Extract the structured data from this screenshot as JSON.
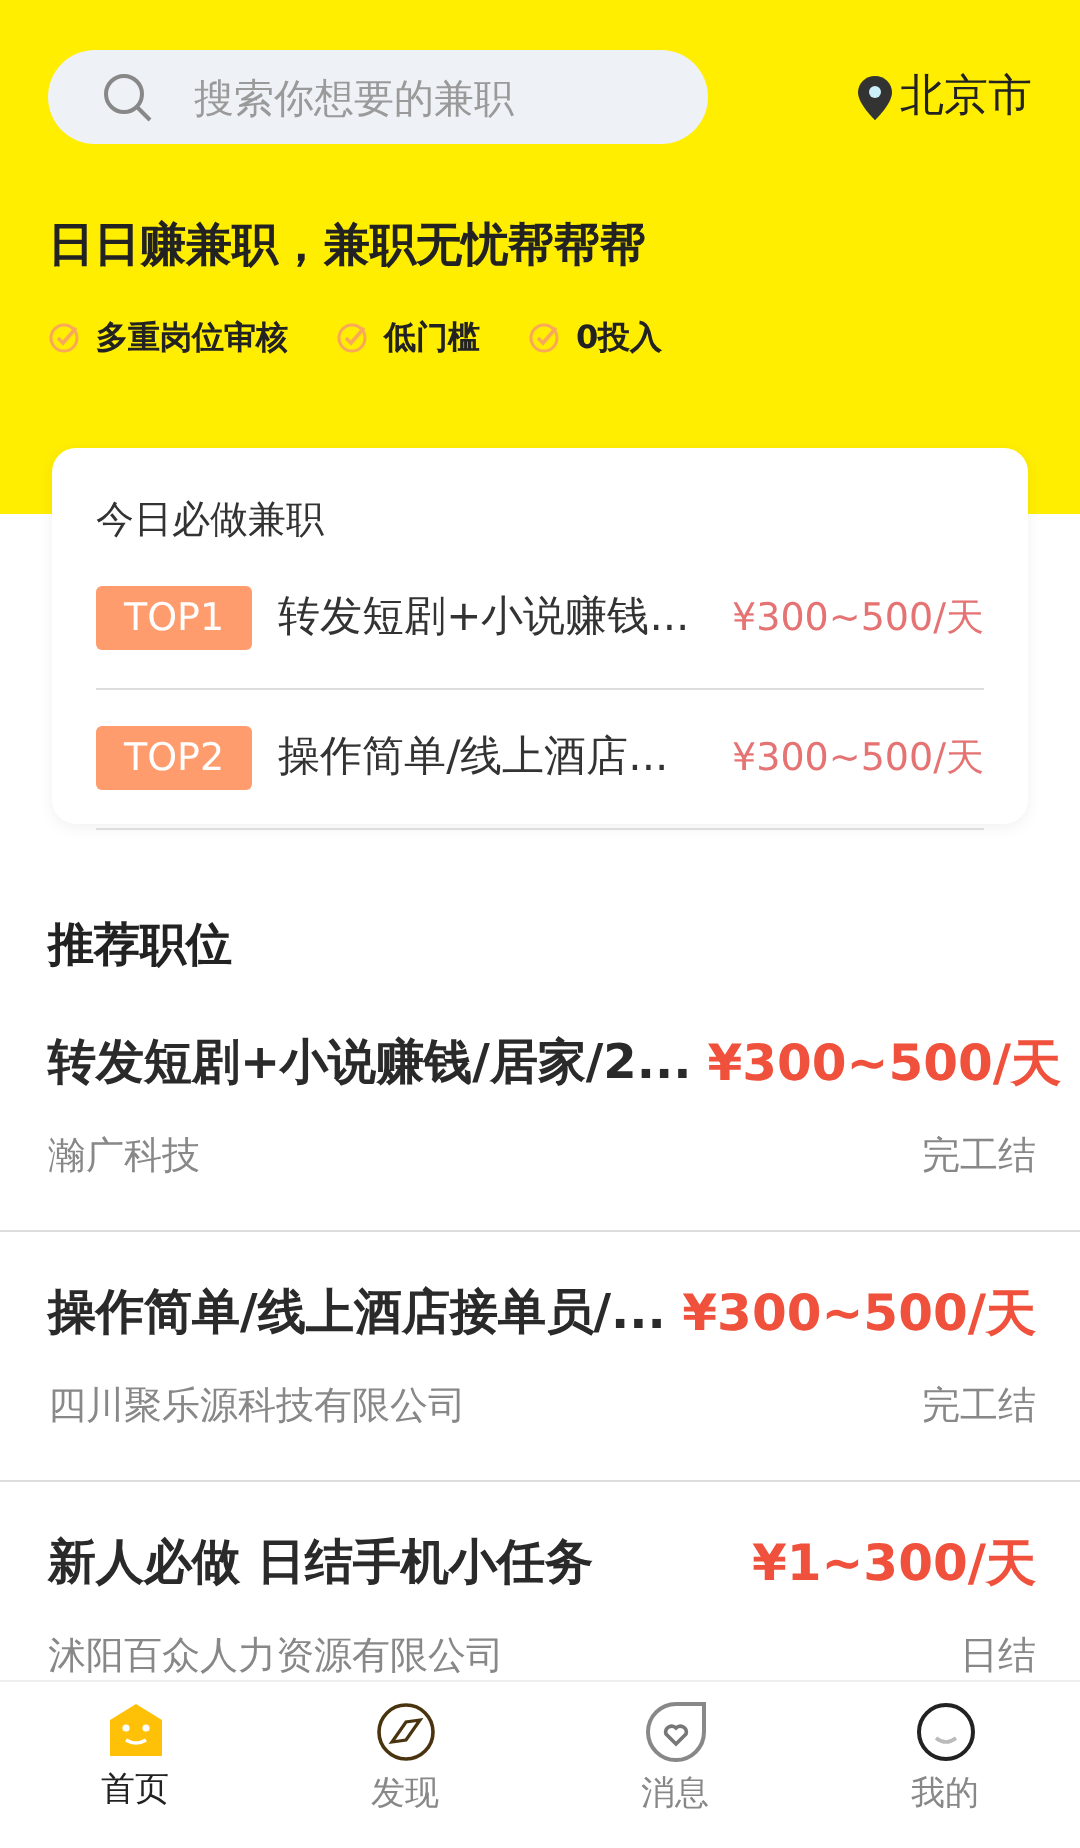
{
  "search": {
    "placeholder": "搜索你想要的兼职"
  },
  "location": "北京市",
  "headline": "日日赚兼职，兼职无忧帮帮帮",
  "features": [
    "多重岗位审核",
    "低门槛",
    "0投入"
  ],
  "daily_card": {
    "title": "今日必做兼职",
    "items": [
      {
        "rank": "TOP1",
        "title": "转发短剧+小说赚钱...",
        "pay": "¥300~500/天"
      },
      {
        "rank": "TOP2",
        "title": "操作简单/线上酒店...",
        "pay": "¥300~500/天"
      }
    ]
  },
  "section_title": "推荐职位",
  "jobs": [
    {
      "title": "转发短剧+小说赚钱/居家/2...",
      "pay": "¥300~500/天",
      "company": "瀚广科技",
      "settlement": "完工结"
    },
    {
      "title": "操作简单/线上酒店接单员/...",
      "pay": "¥300~500/天",
      "company": "四川聚乐源科技有限公司",
      "settlement": "完工结"
    },
    {
      "title": "新人必做 日结手机小任务",
      "pay": "¥1~300/天",
      "company": "沭阳百众人力资源有限公司",
      "settlement": "日结"
    }
  ],
  "tabs": [
    {
      "label": "首页",
      "kind": "home",
      "selected": true
    },
    {
      "label": "发现",
      "kind": "discover",
      "selected": false
    },
    {
      "label": "消息",
      "kind": "messages",
      "selected": false
    },
    {
      "label": "我的",
      "kind": "profile",
      "selected": false
    }
  ]
}
